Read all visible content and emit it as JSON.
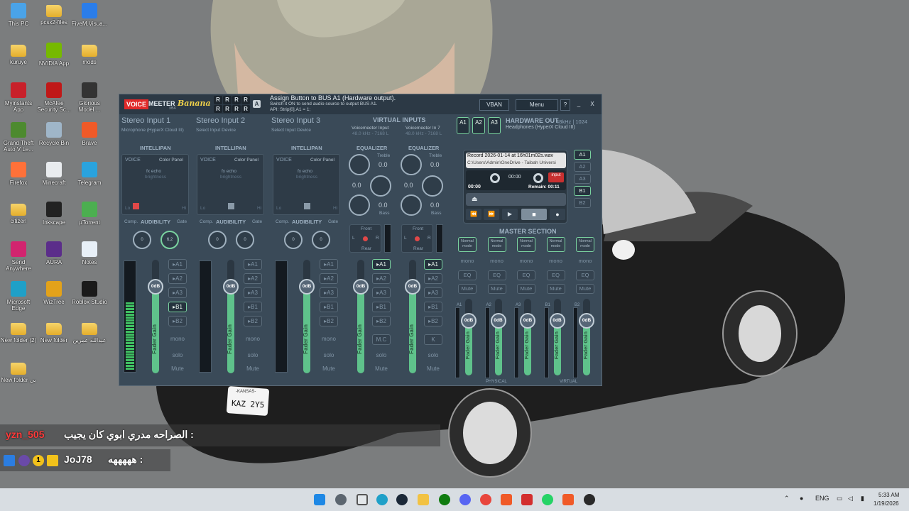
{
  "desktop": {
    "icons": [
      {
        "label": "This PC",
        "color": "#4aa3e8"
      },
      {
        "label": "pcsx2-files",
        "color": "folder"
      },
      {
        "label": "FiveM.Visua...",
        "color": "#2b7de9"
      },
      {
        "label": "kuruye",
        "color": "folder"
      },
      {
        "label": "NVIDIA App",
        "color": "#76b900"
      },
      {
        "label": "mods",
        "color": "folder"
      },
      {
        "label": "Myinstants App",
        "color": "#c8202a"
      },
      {
        "label": "McAfee Security Sc...",
        "color": "#c01818"
      },
      {
        "label": "Glorious Model ...",
        "color": "#333333"
      },
      {
        "label": "Grand Theft Auto V Le...",
        "color": "#4d8a2f"
      },
      {
        "label": "Recycle Bin",
        "color": "#9fb6c9"
      },
      {
        "label": "Brave",
        "color": "#f05a28"
      },
      {
        "label": "Firefox",
        "color": "#ff7139"
      },
      {
        "label": "Minecraft",
        "color": "#e9ecef"
      },
      {
        "label": "Telegram",
        "color": "#2aa3de"
      },
      {
        "label": "citizen",
        "color": "folder"
      },
      {
        "label": "Inkscape",
        "color": "#222222"
      },
      {
        "label": "µTorrent",
        "color": "#4caf50"
      },
      {
        "label": "Send Anywhere",
        "color": "#d2246f"
      },
      {
        "label": "AURA",
        "color": "#5b2d8a"
      },
      {
        "label": "Notes",
        "color": "#e8f0f8"
      },
      {
        "label": "Microsoft Edge",
        "color": "#1fa0c8"
      },
      {
        "label": "WizTree",
        "color": "#e3a21a"
      },
      {
        "label": "Roblox Studio",
        "color": "#1a1a1a"
      },
      {
        "label": "New folder (2)",
        "color": "folder"
      },
      {
        "label": "New folder",
        "color": "folder"
      },
      {
        "label": "عبدالله عمرين",
        "color": "folder"
      },
      {
        "label": "New folder بي",
        "color": "folder"
      }
    ],
    "plate_state": "-KANSAS-",
    "plate_number": "KAZ 2Y5"
  },
  "voicemeeter": {
    "brand_voice": "VOICE",
    "brand_meeter": "MEETER",
    "brand_banana": "Banana",
    "brand_x64": "x64",
    "r_buttons": [
      "R",
      "R",
      "R",
      "R",
      "R",
      "R",
      "R",
      "R"
    ],
    "a_badge": "A",
    "message_line1": "Assign Button to BUS A1 (Hardware output).",
    "message_line2": "Switch it ON to send audio source to output BUS A1.",
    "message_line3": "API: Strip[0].A1 = 1;",
    "vban_label": "VBAN",
    "menu_label": "Menu",
    "help_label": "?",
    "minimize_label": "_",
    "close_label": "X",
    "strips": [
      {
        "name": "Stereo Input 1",
        "device": "Microphone (HyperX Cloud III)"
      },
      {
        "name": "Stereo Input 2",
        "device": "Select Input Device"
      },
      {
        "name": "Stereo Input 3",
        "device": "Select Input Device"
      }
    ],
    "virtual_inputs_title": "VIRTUAL INPUTS",
    "virtual_inputs": [
      {
        "name": "Voicemeeter Input",
        "rate": "48.0 kHz - 7168 L"
      },
      {
        "name": "Voicemeeter In 7",
        "rate": "48.0 kHz - 7168 L"
      }
    ],
    "hw_out_buttons": [
      "A1",
      "A2",
      "A3"
    ],
    "hardware_out_title": "HARDWARE OUT",
    "hardware_out_rate": "48kHz | 1024",
    "hardware_out_device": "Headphones (HyperX Cloud III)",
    "intellipan_label": "INTELLIPAN",
    "voice_label": "VOICE",
    "color_panel_label": "Color Panel",
    "fx_echo_label": "fx echo",
    "brightness_label": "brightness",
    "lo_label": "Lo",
    "hi_label": "Hi",
    "equalizer_label": "EQUALIZER",
    "treble_label": "Treble",
    "bass_label": "Bass",
    "eq_zero": "0.0",
    "comp_label": "Comp.",
    "audibility_label": "AUDIBILITY",
    "gate_label": "Gate",
    "knob_values": [
      "0",
      "6.2",
      "0",
      "0",
      "0",
      "0"
    ],
    "front_label": "Front",
    "rear_label": "Rear",
    "l_label": "L",
    "r_label": "R",
    "fader_gain": "Fader Gain",
    "fader_db": "0dB",
    "bus_labels": [
      "A1",
      "A2",
      "A3",
      "B1",
      "B2"
    ],
    "mono_label": "mono",
    "solo_label": "solo",
    "mute_label": "Mute",
    "mc_label": "M.C",
    "k_label": "K",
    "recorder": {
      "file": "Record 2026-01-14 at 16h01m02s.wav",
      "path": "C:\\Users\\Admin\\OneDrive - Taibah Universi",
      "counter": "00:00",
      "input_label": "input",
      "time": "00:00",
      "remain": "Remain: 00:11",
      "side_buttons": [
        "A1",
        "A2",
        "A3",
        "B1",
        "B2"
      ]
    },
    "master_section_title": "MASTER SECTION",
    "normal_mode": "Normal mode",
    "eq_label": "EQ",
    "master_bus_labels": [
      "A1",
      "A2",
      "A3",
      "B1",
      "B2"
    ],
    "physical_label": "PHYSICAL",
    "virtual_label": "VIRTUAL"
  },
  "chat": [
    {
      "user": "yzn_505",
      "message": "الصراحه مدري ابوي كان يجيب :"
    },
    {
      "user": "JoJ78",
      "message": "هههههه :",
      "badge": "1"
    }
  ],
  "taskbar": {
    "lang": "ENG",
    "time": "5:33 AM",
    "date": "1/19/2026"
  }
}
